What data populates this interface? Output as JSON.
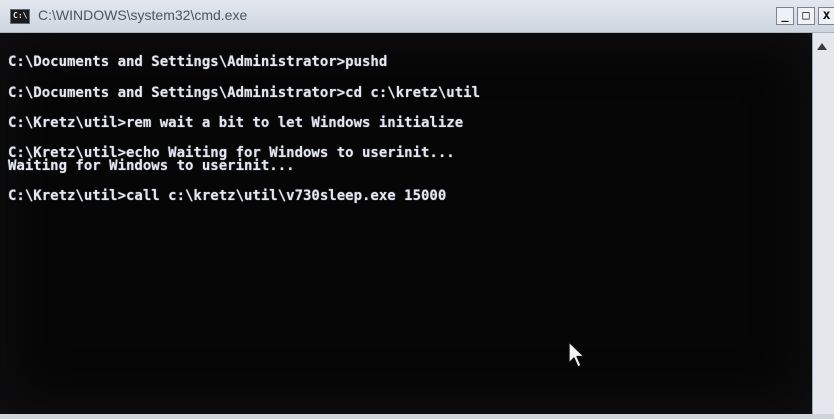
{
  "window": {
    "title": "C:\\WINDOWS\\system32\\cmd.exe",
    "icon": "console-app-icon",
    "icon_text": "C:\\",
    "controls": {
      "minimize_label": "_",
      "maximize_label": "□",
      "close_label": "x"
    }
  },
  "console": {
    "lines": [
      "C:\\Documents and Settings\\Administrator>pushd",
      "C:\\Documents and Settings\\Administrator>cd c:\\kretz\\util",
      "C:\\Kretz\\util>rem wait a bit to let Windows initialize",
      "C:\\Kretz\\util>echo Waiting for Windows to userinit...",
      "Waiting for Windows to userinit...",
      "C:\\Kretz\\util>call c:\\kretz\\util\\v730sleep.exe 15000"
    ],
    "background": "#060606",
    "text_color": "#e3e6ef"
  },
  "scrollbar": {
    "up_icon": "scroll-up-arrow-icon"
  },
  "pointer": {
    "icon": "mouse-pointer-icon"
  }
}
